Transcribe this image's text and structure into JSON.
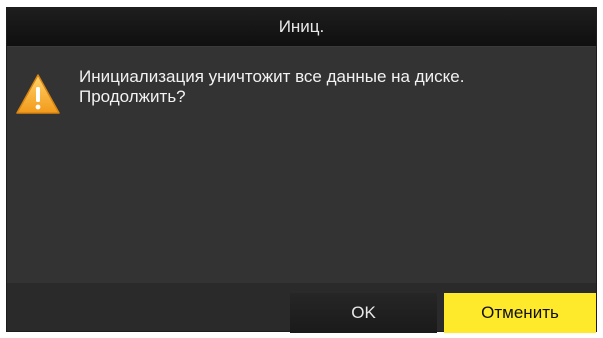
{
  "dialog": {
    "title": "Иниц.",
    "message_line1": "Инициализация уничтожит все данные на диске.",
    "message_line2": "Продолжить?",
    "icon": "warning-icon"
  },
  "buttons": {
    "ok_label": "OK",
    "cancel_label": "Отменить"
  },
  "colors": {
    "dialog_background": "#333333",
    "title_background": "#141414",
    "focused_button": "#ffe92b",
    "warning_icon": "#f5a623"
  }
}
